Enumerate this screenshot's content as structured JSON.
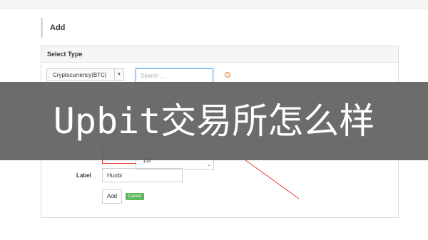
{
  "header": {
    "section_title": "Add"
  },
  "select_type": {
    "title": "Select Type",
    "select_value": "Cryptocurrency(BTC)",
    "search_placeholder": "Search ...",
    "dropdown_option": "ZB"
  },
  "form": {
    "label_text": "Label",
    "label_value": "Huobi",
    "add_label": "Add",
    "cancel_label": "Cancel"
  },
  "overlay": {
    "banner_text": "Upbit交易所怎么样"
  },
  "colors": {
    "focus": "#66afe9",
    "cancel": "#5cb85c",
    "annotation": "#e53935",
    "banner": "#5f5f5f"
  }
}
